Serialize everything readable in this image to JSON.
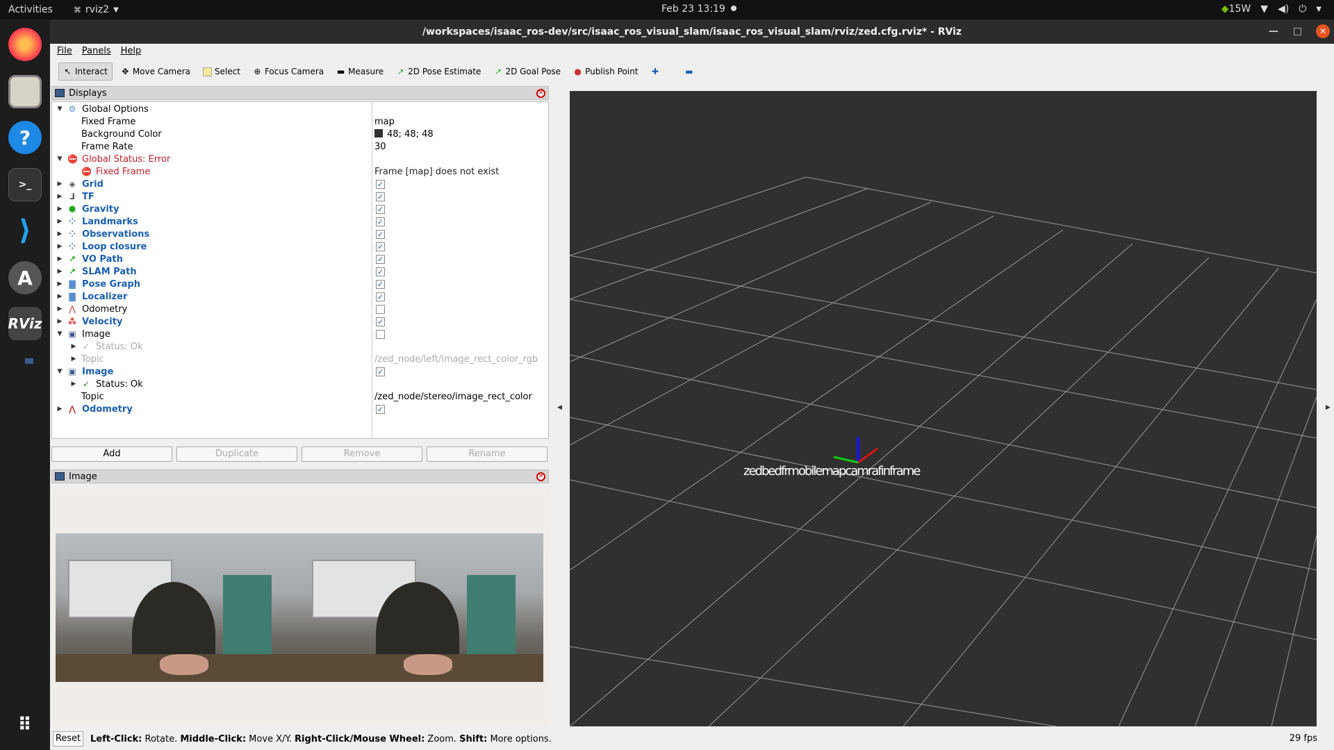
{
  "topbar": {
    "activities": "Activities",
    "app_name": "rviz2",
    "clock": "Feb 23  13:19",
    "power": "15W"
  },
  "window": {
    "title": "/workspaces/isaac_ros-dev/src/isaac_ros_visual_slam/isaac_ros_visual_slam/rviz/zed.cfg.rviz* - RViz"
  },
  "menu": {
    "file": "File",
    "panels": "Panels",
    "help": "Help"
  },
  "toolbar": {
    "interact": "Interact",
    "move_camera": "Move Camera",
    "select": "Select",
    "focus_camera": "Focus Camera",
    "measure": "Measure",
    "pose_estimate": "2D Pose Estimate",
    "goal_pose": "2D Goal Pose",
    "publish_point": "Publish Point"
  },
  "displays": {
    "title": "Displays",
    "rows": [
      {
        "name": "Global Options",
        "value": ""
      },
      {
        "name": "Fixed Frame",
        "value": "map"
      },
      {
        "name": "Background Color",
        "value": "48; 48; 48"
      },
      {
        "name": "Frame Rate",
        "value": "30"
      },
      {
        "name": "Global Status: Error",
        "value": ""
      },
      {
        "name": "Fixed Frame",
        "value": "Frame [map] does not exist"
      },
      {
        "name": "Grid",
        "value": "true"
      },
      {
        "name": "TF",
        "value": "true"
      },
      {
        "name": "Gravity",
        "value": "true"
      },
      {
        "name": "Landmarks",
        "value": "true"
      },
      {
        "name": "Observations",
        "value": "true"
      },
      {
        "name": "Loop closure",
        "value": "true"
      },
      {
        "name": "VO Path",
        "value": "true"
      },
      {
        "name": "SLAM Path",
        "value": "true"
      },
      {
        "name": "Pose Graph",
        "value": "true"
      },
      {
        "name": "Localizer",
        "value": "true"
      },
      {
        "name": "Odometry",
        "value": "false"
      },
      {
        "name": "Velocity",
        "value": "true"
      },
      {
        "name": "Image",
        "value": "false"
      },
      {
        "name": "Status: Ok",
        "value": ""
      },
      {
        "name": "Topic",
        "value": "/zed_node/left/image_rect_color_rgb"
      },
      {
        "name": "Image",
        "value": "true"
      },
      {
        "name": "Status: Ok",
        "value": ""
      },
      {
        "name": "Topic",
        "value": "/zed_node/stereo/image_rect_color"
      },
      {
        "name": "Odometry",
        "value": "true"
      }
    ]
  },
  "buttons": {
    "add": "Add",
    "duplicate": "Duplicate",
    "remove": "Remove",
    "rename": "Rename"
  },
  "image_panel": {
    "title": "Image"
  },
  "view3d": {
    "overlay_text": "zedbedfrmobilemapcamrafinframe"
  },
  "statusbar": {
    "reset": "Reset",
    "hint_left": "Left-Click:",
    "hint_left_desc": " Rotate. ",
    "hint_middle": "Middle-Click:",
    "hint_middle_desc": " Move X/Y. ",
    "hint_right": "Right-Click/Mouse Wheel:",
    "hint_right_desc": " Zoom. ",
    "hint_shift": "Shift:",
    "hint_shift_desc": " More options.",
    "fps": "29 fps"
  },
  "colors": {
    "grid_bg": "#303030",
    "accent_blue": "#1a5fb4",
    "error_red": "#c01c28"
  }
}
